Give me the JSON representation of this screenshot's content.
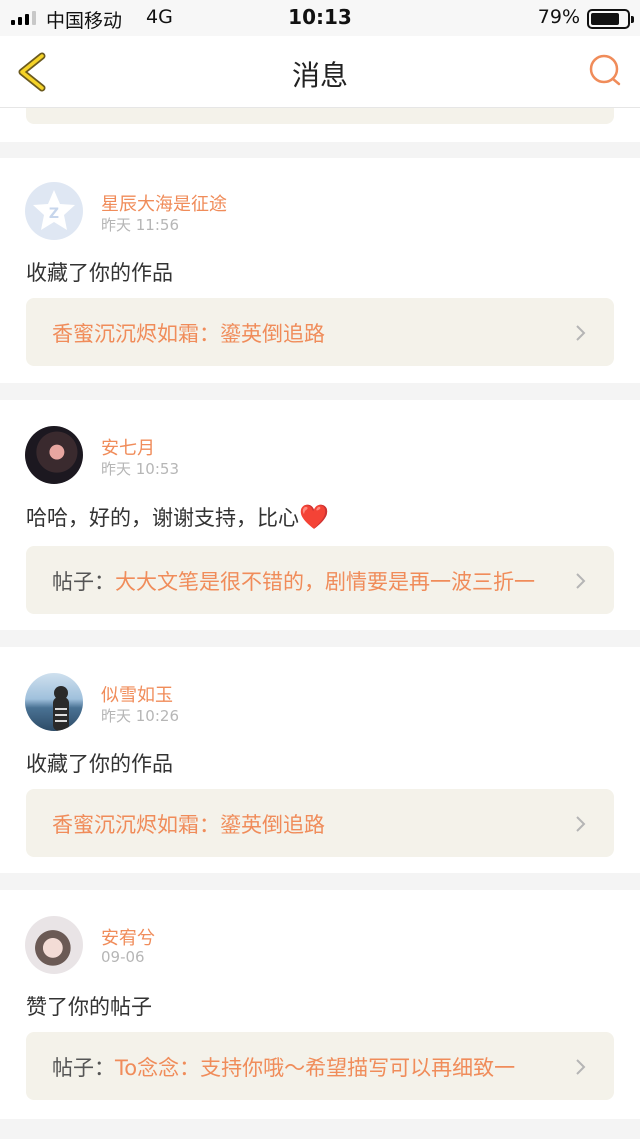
{
  "status_bar": {
    "carrier": "中国移动",
    "network": "4G",
    "time": "10:13",
    "battery_percent": "79%",
    "battery_level": 0.79
  },
  "navbar": {
    "title": "消息",
    "back_icon": "chevron-left-icon",
    "search_icon": "search-icon",
    "accent_color": "#f08c5a"
  },
  "messages": [
    {
      "username": "星辰大海是征途",
      "time": "昨天 11:56",
      "content": "收藏了你的作品",
      "ref_prefix": "",
      "ref_text": "香蜜沉沉烬如霜：鎏英倒追路"
    },
    {
      "username": "安七月",
      "time": "昨天 10:53",
      "content": "哈哈，好的，谢谢支持，比心",
      "emoji": "❤️",
      "ref_prefix": "帖子：",
      "ref_text": "大大文笔是很不错的，剧情要是再一波三折一"
    },
    {
      "username": "似雪如玉",
      "time": "昨天 10:26",
      "content": "收藏了你的作品",
      "ref_prefix": "",
      "ref_text": "香蜜沉沉烬如霜：鎏英倒追路"
    },
    {
      "username": "安宥兮",
      "time": "09-06",
      "content": "赞了你的帖子",
      "ref_prefix": "帖子：",
      "ref_text": "To念念：支持你哦～希望描写可以再细致一"
    }
  ]
}
